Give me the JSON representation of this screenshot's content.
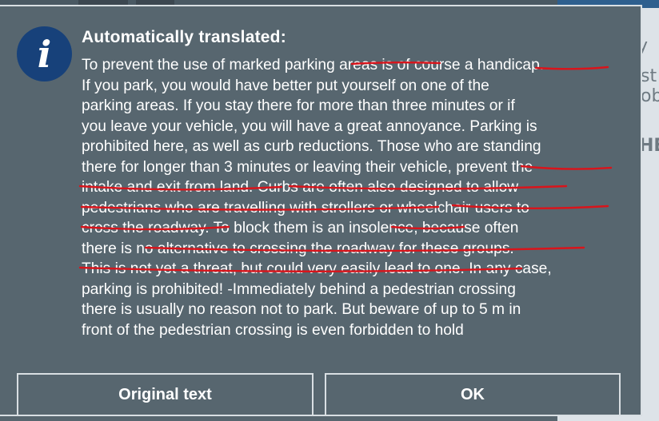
{
  "dialog": {
    "icon": "info-icon",
    "title": "Automatically translated:",
    "body_lines": [
      "To prevent the use of marked parking areas is of course a handicap.",
      "If you park, you would have better put yourself on one of the",
      "parking areas. If you stay there for more than three minutes or if",
      "you leave your vehicle, you will have a great annoyance. Parking is",
      "prohibited here, as well as curb reductions. Those who are standing",
      "there for longer than 3 minutes or leaving their vehicle, prevent the",
      "intake and exit from land. Curbs are often also designed to allow",
      "pedestrians who are travelling with strollers or wheelchair users to",
      "cross the roadway. To block them is an insolence, because often",
      "there is no alternative to crossing the roadway for these groups.",
      "This is not yet a threat, but could very easily lead to one. In any case,",
      "parking is prohibited! -Immediately behind a pedestrian crossing",
      "there is usually no reason not to park. But beware of up to 5 m in",
      "front of the pedestrian crossing is even forbidden to hold"
    ],
    "buttons": {
      "original_label": "Original text",
      "ok_label": "OK"
    },
    "annotation_color": "#d9141b"
  },
  "background": {
    "fragments": [
      "y",
      "st",
      "ob",
      "HE"
    ]
  }
}
